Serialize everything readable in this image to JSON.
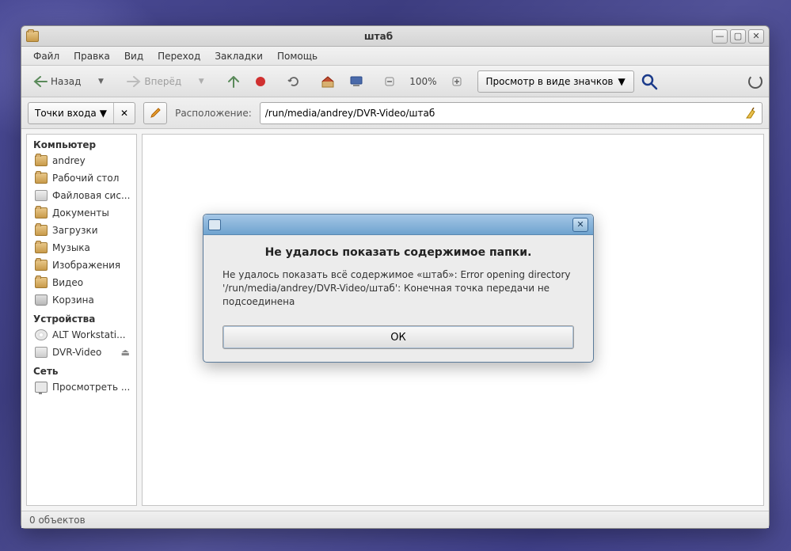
{
  "window": {
    "title": "штаб",
    "controls": {
      "min": "—",
      "max": "▢",
      "close": "✕"
    }
  },
  "menubar": [
    "Файл",
    "Правка",
    "Вид",
    "Переход",
    "Закладки",
    "Помощь"
  ],
  "toolbar": {
    "back": "Назад",
    "forward": "Вперёд",
    "zoom": "100%",
    "viewmode": "Просмотр в виде значков"
  },
  "locbar": {
    "entrypoints": "Точки входа",
    "entry_clear": "✕",
    "label": "Расположение:",
    "path": "/run/media/andrey/DVR-Video/штаб"
  },
  "sidebar": {
    "groups": [
      {
        "title": "Компьютер",
        "items": [
          {
            "icon": "home",
            "label": "andrey"
          },
          {
            "icon": "folder",
            "label": "Рабочий стол"
          },
          {
            "icon": "disk",
            "label": "Файловая сис..."
          },
          {
            "icon": "folder",
            "label": "Документы"
          },
          {
            "icon": "folder",
            "label": "Загрузки"
          },
          {
            "icon": "folder",
            "label": "Музыка"
          },
          {
            "icon": "folder",
            "label": "Изображения"
          },
          {
            "icon": "folder",
            "label": "Видео"
          },
          {
            "icon": "trash",
            "label": "Корзина"
          }
        ]
      },
      {
        "title": "Устройства",
        "items": [
          {
            "icon": "cd",
            "label": "ALT Workstati..."
          },
          {
            "icon": "disk",
            "label": "DVR-Video",
            "eject": true
          }
        ]
      },
      {
        "title": "Сеть",
        "items": [
          {
            "icon": "net",
            "label": "Просмотреть ..."
          }
        ]
      }
    ]
  },
  "status": "0 объектов",
  "dialog": {
    "heading": "Не удалось показать содержимое папки.",
    "message": "Не удалось показать всё содержимое «штаб»: Error opening directory '/run/media/andrey/DVR-Video/штаб': Конечная точка передачи не подсоединена",
    "ok": "ОК",
    "close": "✕"
  }
}
